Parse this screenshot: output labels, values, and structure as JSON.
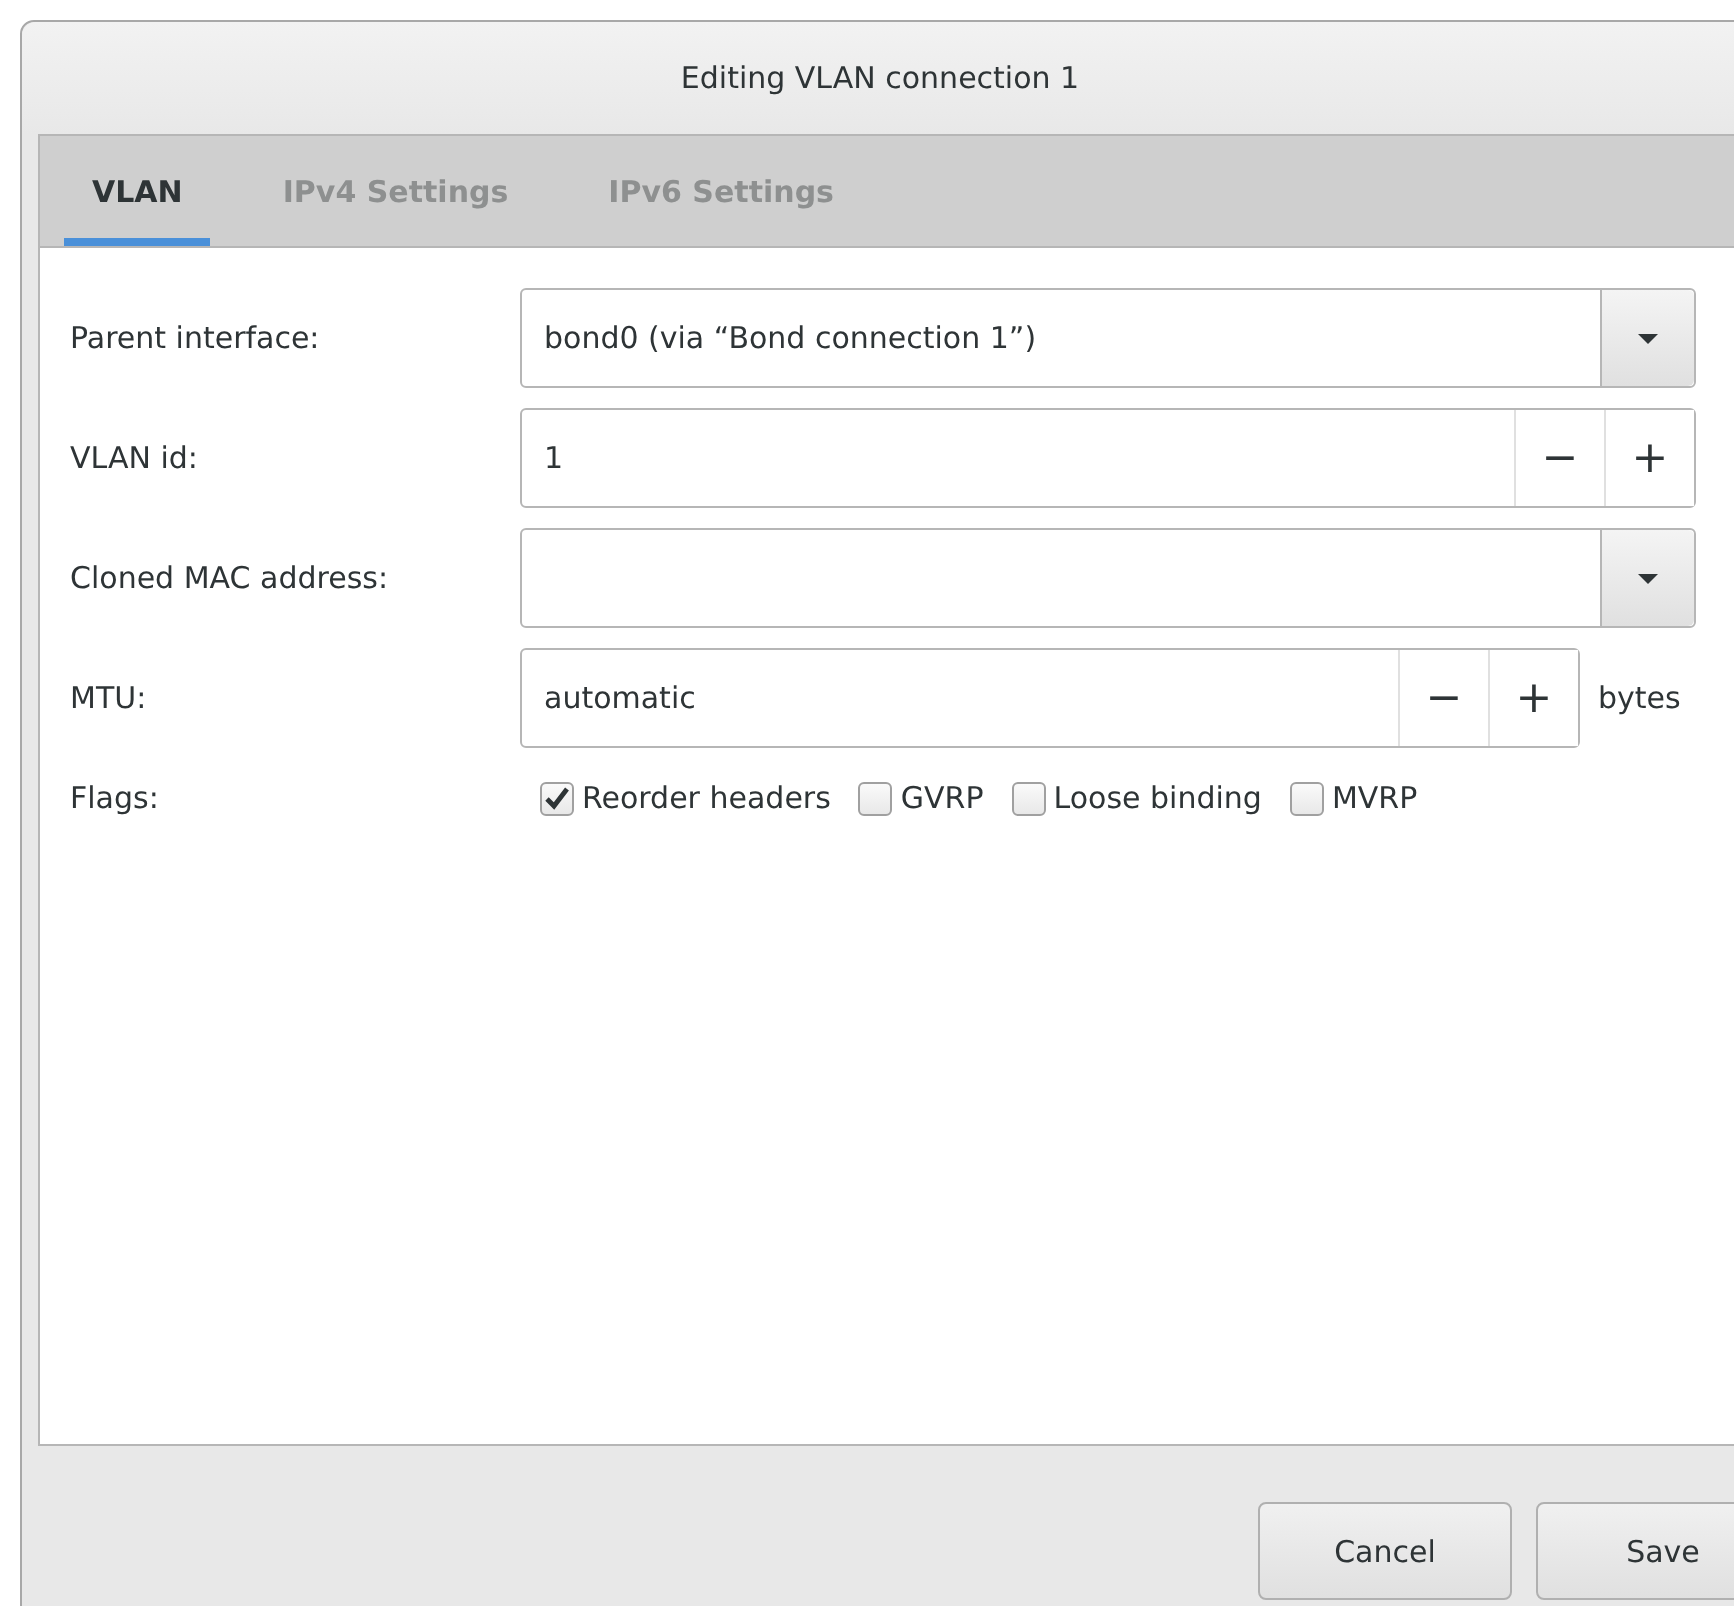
{
  "window": {
    "title": "Editing VLAN connection 1"
  },
  "tabs": [
    {
      "label": "VLAN",
      "selected": true
    },
    {
      "label": "IPv4 Settings",
      "selected": false
    },
    {
      "label": "IPv6 Settings",
      "selected": false
    }
  ],
  "fields": [
    {
      "kind": "combo",
      "label": "Parent interface:",
      "value": "bond0 (via “Bond connection 1”)"
    },
    {
      "kind": "spin",
      "label": "VLAN id:",
      "value": "1",
      "minus": "−",
      "plus": "+"
    },
    {
      "kind": "combo",
      "label": "Cloned MAC address:"
    },
    {
      "kind": "spin",
      "label": "MTU:",
      "value": "automatic",
      "minus": "−",
      "plus": "+",
      "unit": "bytes"
    },
    {
      "kind": "checks",
      "label": "Flags:",
      "options": [
        {
          "label": "Reorder headers",
          "checked": true
        },
        {
          "label": "GVRP",
          "checked": false
        },
        {
          "label": "Loose binding",
          "checked": false
        },
        {
          "label": "MVRP",
          "checked": false
        }
      ]
    }
  ],
  "buttons": [
    "Cancel",
    "Save"
  ]
}
